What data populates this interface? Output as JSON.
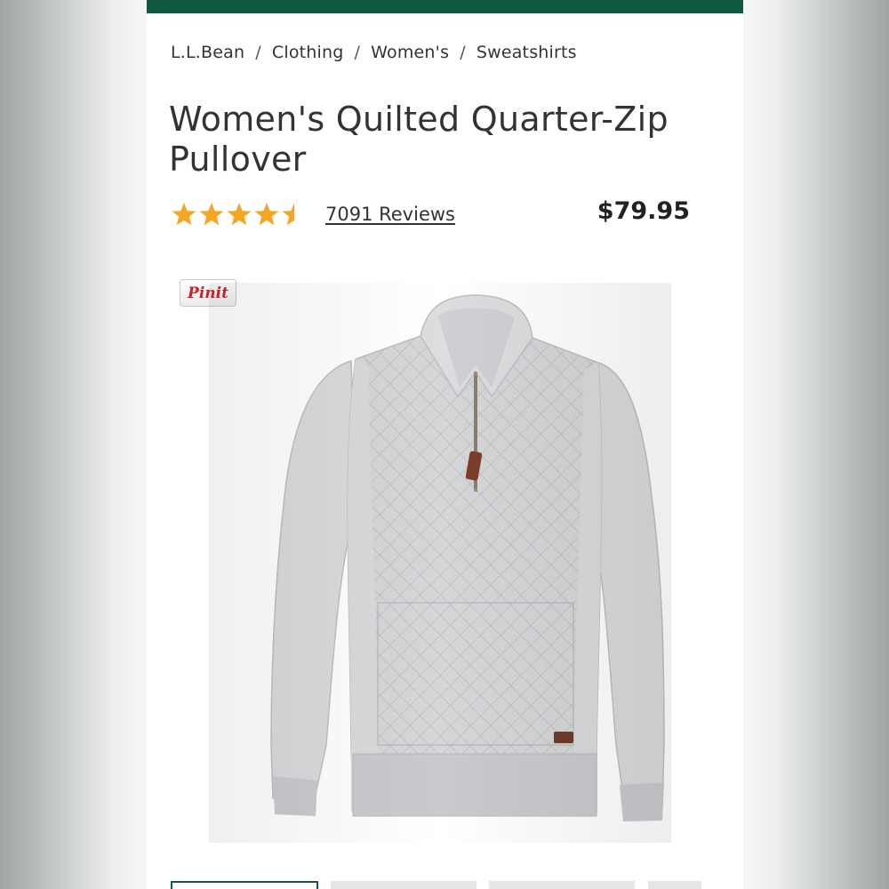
{
  "colors": {
    "brand_bar": "#0e5a40",
    "star": "#f5a623",
    "text": "#333333",
    "pin_red": "#c8232c"
  },
  "breadcrumb": [
    "L.L.Bean",
    "Clothing",
    "Women's",
    "Sweatshirts"
  ],
  "breadcrumb_separator": "/",
  "product": {
    "title": "Women's Quilted Quarter-Zip Pullover",
    "rating": 4.5,
    "rating_max": 5,
    "reviews_label": "7091 Reviews",
    "price": "$79.95"
  },
  "pin_button": "Pinit",
  "icons": {
    "star": "star-icon",
    "half_star": "half-star-icon"
  },
  "image": {
    "subject": "quilted-quarter-zip-pullover"
  },
  "thumbnails_count": 4
}
